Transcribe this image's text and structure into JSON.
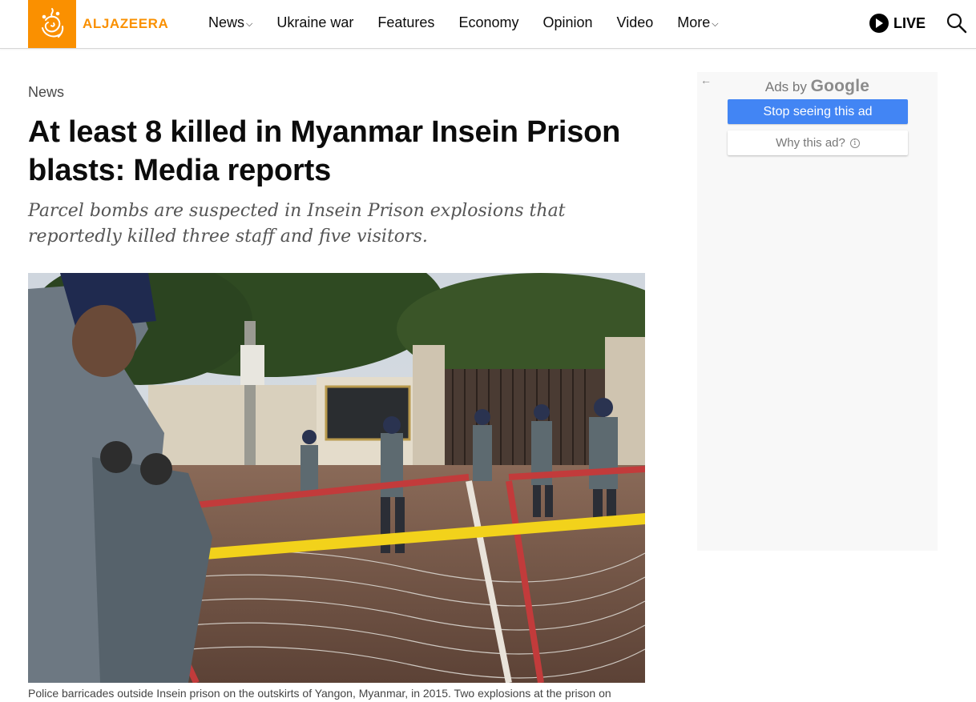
{
  "header": {
    "brand": "ALJAZEERA",
    "logo_icon": "aljazeera-calligraphy-logo",
    "nav": [
      {
        "label": "News",
        "has_dropdown": true
      },
      {
        "label": "Ukraine war",
        "has_dropdown": false
      },
      {
        "label": "Features",
        "has_dropdown": false
      },
      {
        "label": "Economy",
        "has_dropdown": false
      },
      {
        "label": "Opinion",
        "has_dropdown": false
      },
      {
        "label": "Video",
        "has_dropdown": false
      },
      {
        "label": "More",
        "has_dropdown": true
      }
    ],
    "live_label": "LIVE",
    "live_icon": "play-circle-icon",
    "search_icon": "search-icon"
  },
  "article": {
    "section": "News",
    "headline": "At least 8 killed in Myanmar Insein Prison blasts: Media reports",
    "subheadline": "Parcel bombs are suspected in Insein Prison explosions that reportedly killed three staff and five visitors.",
    "photo_caption": "Police barricades outside Insein prison on the outskirts of Yangon, Myanmar, in 2015. Two explosions at the prison on"
  },
  "ad": {
    "back_icon": "←",
    "ads_by": "Ads by",
    "google": "Google",
    "stop_label": "Stop seeing this ad",
    "why_label": "Why this ad?",
    "why_icon": "i"
  },
  "colors": {
    "brand_orange": "#fa9000",
    "ad_button_blue": "#4285f4"
  }
}
